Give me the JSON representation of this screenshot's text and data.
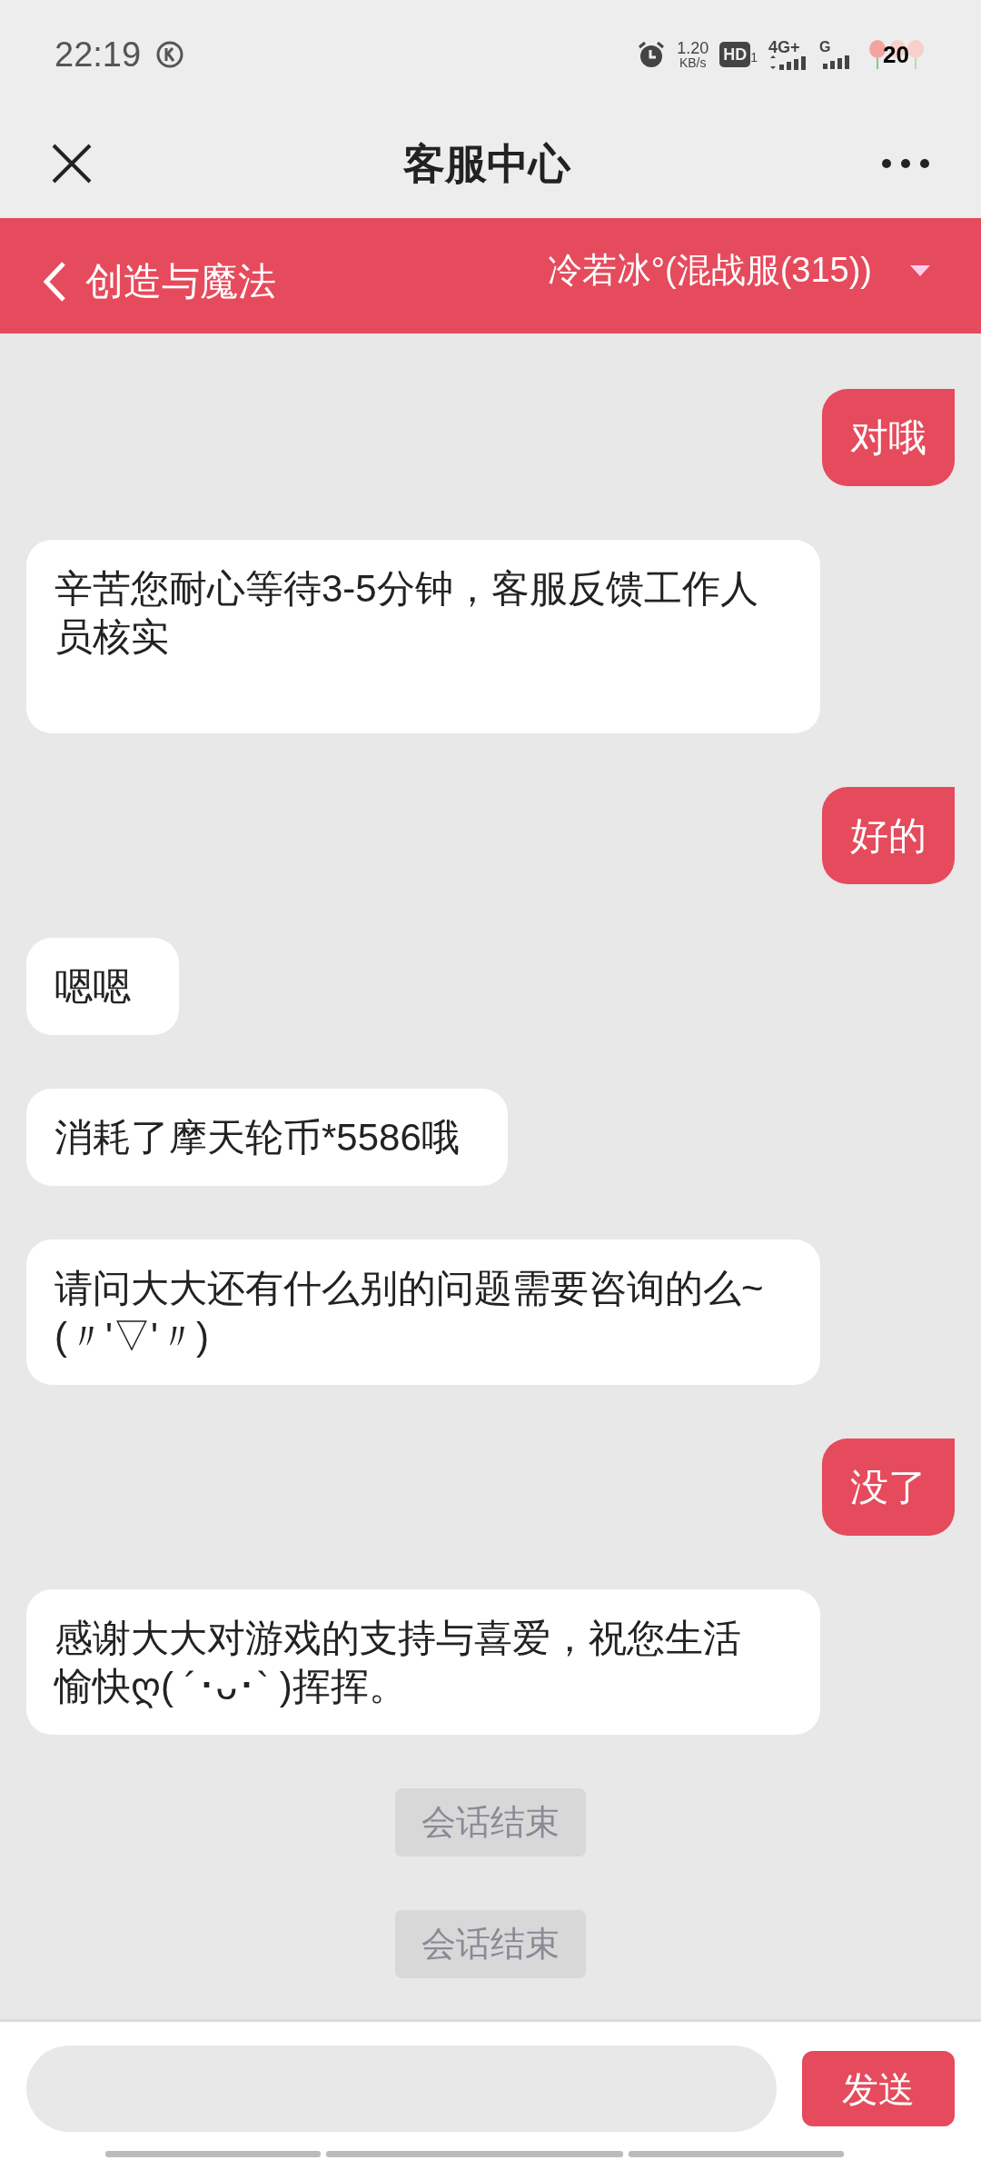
{
  "status_bar": {
    "time": "22:19",
    "speed": "1.20",
    "speed_unit": "KB/s",
    "hd": "HD",
    "hd_sim": "1",
    "network_1": "4G+",
    "network_2": "G",
    "battery": "20"
  },
  "title_bar": {
    "title": "客服中心"
  },
  "game_bar": {
    "game": "创造与魔法",
    "server": "冷若冰°(混战服(315))"
  },
  "messages": [
    {
      "kind": "sent",
      "text": "对哦"
    },
    {
      "kind": "received",
      "text": "辛苦您耐心等待3-5分钟，客服反馈工作人员核实\n"
    },
    {
      "kind": "sent",
      "text": "好的"
    },
    {
      "kind": "received",
      "text": "嗯嗯"
    },
    {
      "kind": "received",
      "text": "消耗了摩天轮币*5586哦"
    },
    {
      "kind": "received",
      "text": "请问大大还有什么别的问题需要咨询的么~(〃'▽'〃)"
    },
    {
      "kind": "sent",
      "text": "没了"
    },
    {
      "kind": "received",
      "text": "感谢大大对游戏的支持与喜爱，祝您生活愉快ღ( ´･ᴗ･` )挥挥。"
    },
    {
      "kind": "notice",
      "text": "会话结束"
    },
    {
      "kind": "notice",
      "text": "会话结束"
    }
  ],
  "composer": {
    "send": "发送"
  }
}
